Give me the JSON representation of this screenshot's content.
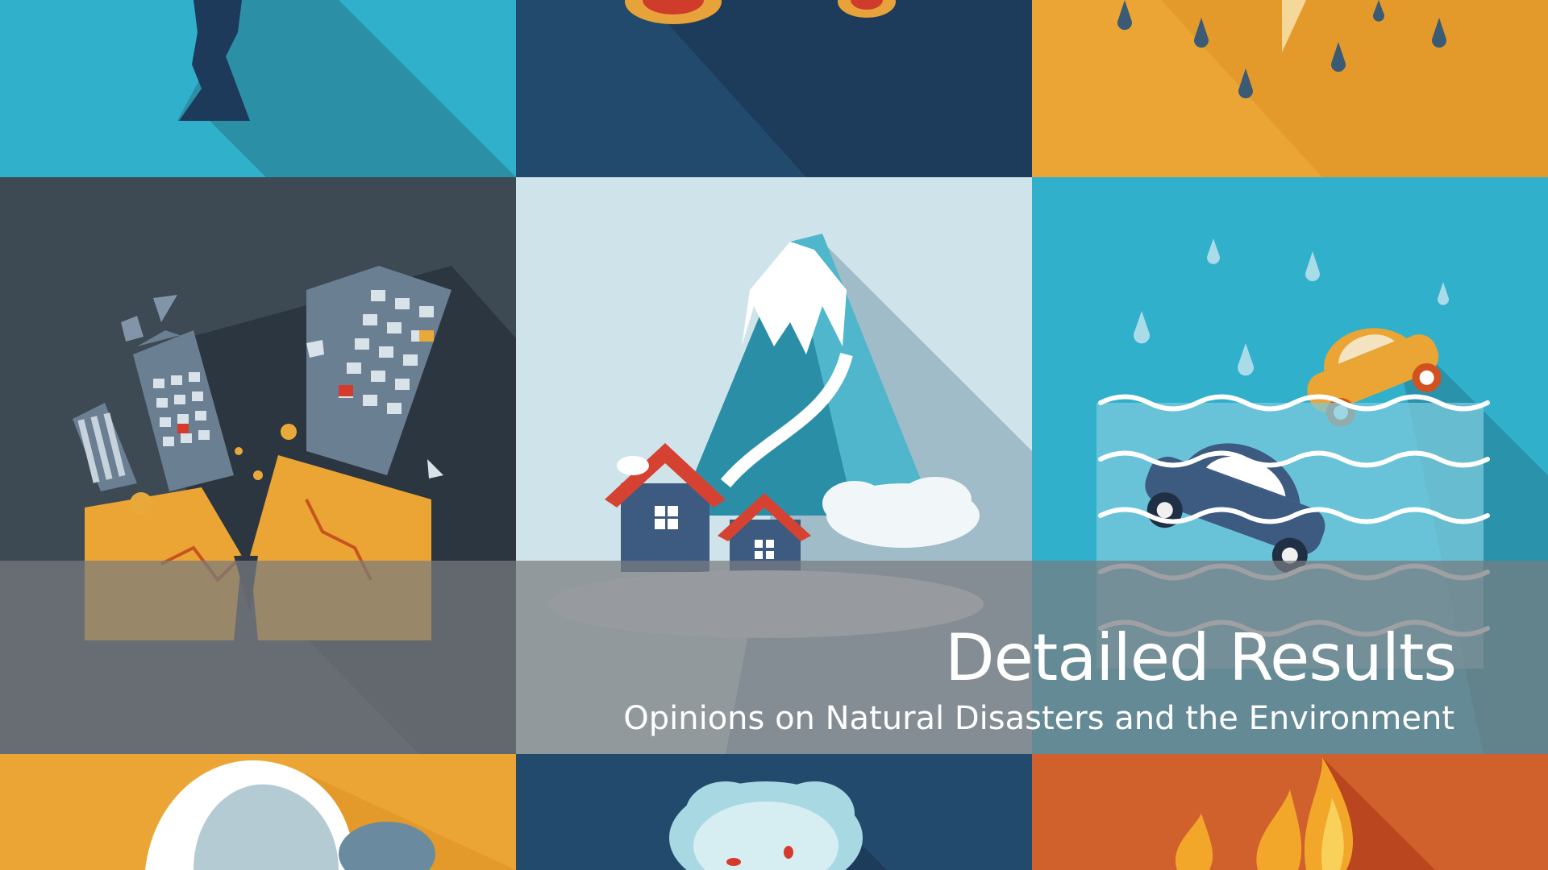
{
  "slide": {
    "title": "Detailed Results",
    "subtitle": "Opinions on Natural Disasters and the Environment"
  },
  "background": {
    "tiles": [
      {
        "icon": "tornado-icon",
        "color": "#31b0cc"
      },
      {
        "icon": "meteor-icon",
        "color": "#1f4a6b"
      },
      {
        "icon": "storm-lightning-icon",
        "color": "#eba534"
      },
      {
        "icon": "earthquake-icon",
        "color": "#3c4a55"
      },
      {
        "icon": "avalanche-icon",
        "color": "#cfe4ea"
      },
      {
        "icon": "flood-icon",
        "color": "#31b0cc"
      },
      {
        "icon": "tsunami-icon",
        "color": "#eba534"
      },
      {
        "icon": "volcano-icon",
        "color": "#1f4a6b"
      },
      {
        "icon": "wildfire-icon",
        "color": "#d0612c"
      }
    ]
  }
}
